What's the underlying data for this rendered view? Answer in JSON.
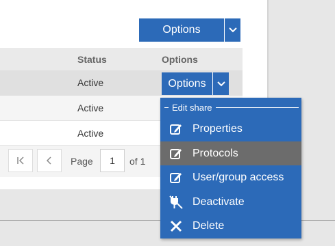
{
  "toolbar": {
    "options_label": "Options"
  },
  "table": {
    "columns": {
      "status": "Status",
      "options": "Options"
    },
    "rows": [
      {
        "status": "Active",
        "options_label": "Options"
      },
      {
        "status": "Active"
      },
      {
        "status": "Active"
      }
    ]
  },
  "pagination": {
    "page_label": "Page",
    "page_value": "1",
    "of_label": "of 1"
  },
  "menu": {
    "section_title": "Edit share",
    "items": [
      {
        "label": "Properties",
        "icon": "edit-icon"
      },
      {
        "label": "Protocols",
        "icon": "edit-icon",
        "active": true
      },
      {
        "label": "User/group access",
        "icon": "edit-icon"
      },
      {
        "label": "Deactivate",
        "icon": "unplug-icon"
      },
      {
        "label": "Delete",
        "icon": "close-icon"
      }
    ]
  },
  "colors": {
    "primary": "#2c6ab8",
    "menu_hover": "#6c6c6c"
  }
}
